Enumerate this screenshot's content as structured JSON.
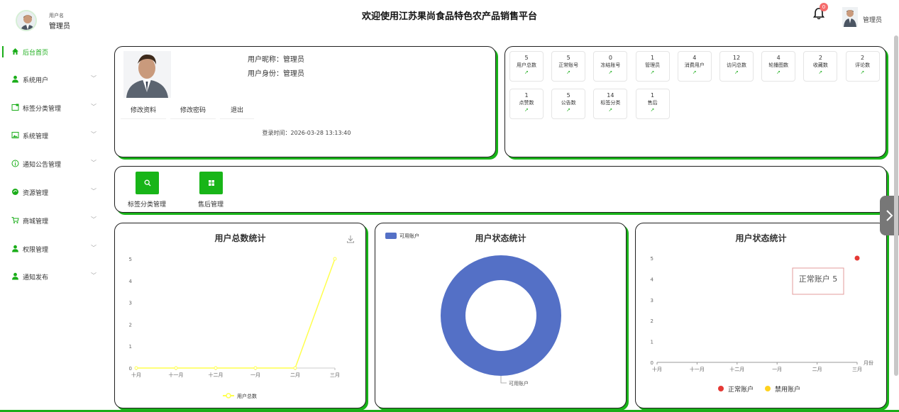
{
  "header": {
    "username_label": "用户名",
    "username": "管理员",
    "title": "欢迎使用江苏果尚食品特色农产品销售平台",
    "notification_count": "0",
    "user_menu_label": "管理员"
  },
  "sidebar": {
    "items": [
      {
        "label": "后台首页",
        "icon": "home-icon",
        "active": true
      },
      {
        "label": "系统用户",
        "icon": "user-icon",
        "active": false
      },
      {
        "label": "标签分类管理",
        "icon": "tag-icon",
        "active": false
      },
      {
        "label": "系统管理",
        "icon": "image-icon",
        "active": false
      },
      {
        "label": "通知公告管理",
        "icon": "info-icon",
        "active": false
      },
      {
        "label": "资源管理",
        "icon": "resource-icon",
        "active": false
      },
      {
        "label": "商城管理",
        "icon": "cart-icon",
        "active": false
      },
      {
        "label": "权限管理",
        "icon": "user-icon",
        "active": false
      },
      {
        "label": "通知发布",
        "icon": "user-icon",
        "active": false
      }
    ]
  },
  "profile": {
    "nickname_line": "用户昵称：管理员",
    "role_line": "用户身份：管理员",
    "edit_profile": "修改资料",
    "change_password": "修改密码",
    "logout": "退出",
    "login_time": "登录时间：2026-03-28 13:13:40"
  },
  "stats": [
    {
      "value": "5",
      "name": "用户总数"
    },
    {
      "value": "5",
      "name": "正常账号"
    },
    {
      "value": "0",
      "name": "冻结账号"
    },
    {
      "value": "1",
      "name": "管理员"
    },
    {
      "value": "4",
      "name": "消费用户"
    },
    {
      "value": "12",
      "name": "访问总数"
    },
    {
      "value": "4",
      "name": "轮播图数"
    },
    {
      "value": "2",
      "name": "收藏数"
    },
    {
      "value": "2",
      "name": "评论数"
    },
    {
      "value": "1",
      "name": "点赞数"
    },
    {
      "value": "5",
      "name": "公告数"
    },
    {
      "value": "14",
      "name": "标签分类"
    },
    {
      "value": "1",
      "name": "售后"
    }
  ],
  "quick_links": [
    {
      "label": "标签分类管理",
      "icon": "search-icon"
    },
    {
      "label": "售后管理",
      "icon": "grid-icon"
    }
  ],
  "colors": {
    "accent": "#1aad19",
    "donut": "#5470c6",
    "line": "#ffff4d",
    "normal": "#e53935",
    "banned": "#ffd21f"
  },
  "chart_data": [
    {
      "type": "line",
      "title": "用户总数统计",
      "categories": [
        "十月",
        "十一月",
        "十二月",
        "一月",
        "二月",
        "三月"
      ],
      "series": [
        {
          "name": "用户总数",
          "values": [
            0,
            0,
            0,
            0,
            0,
            5
          ]
        }
      ],
      "ylim": [
        0,
        5
      ],
      "yticks": [
        "0",
        "1",
        "2",
        "3",
        "4",
        "5"
      ],
      "legend": "bottom"
    },
    {
      "type": "pie",
      "title": "用户状态统计",
      "slices": [
        {
          "label": "可用账户",
          "value": 5
        }
      ],
      "legend": "top-left"
    },
    {
      "type": "scatter",
      "title": "用户状态统计",
      "categories": [
        "十月",
        "十一月",
        "十二月",
        "一月",
        "二月",
        "三月"
      ],
      "xlabel": "月份",
      "ylim": [
        0,
        5
      ],
      "yticks": [
        "0",
        "1",
        "2",
        "3",
        "4",
        "5"
      ],
      "series": [
        {
          "name": "正常账户",
          "values": [
            null,
            null,
            null,
            null,
            null,
            5
          ]
        },
        {
          "name": "禁用账户",
          "values": [
            null,
            null,
            null,
            null,
            null,
            null
          ]
        }
      ],
      "tooltip": "正常账户 5",
      "legend": "bottom"
    }
  ]
}
